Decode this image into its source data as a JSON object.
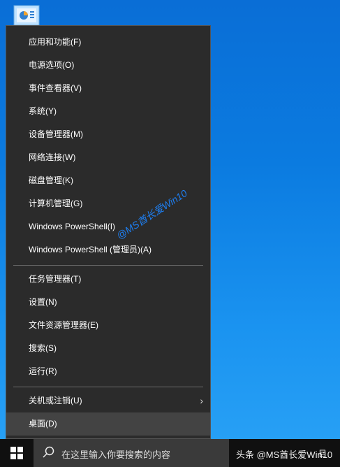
{
  "menu": {
    "items": [
      {
        "label": "应用和功能(F)"
      },
      {
        "label": "电源选项(O)"
      },
      {
        "label": "事件查看器(V)"
      },
      {
        "label": "系统(Y)"
      },
      {
        "label": "设备管理器(M)"
      },
      {
        "label": "网络连接(W)"
      },
      {
        "label": "磁盘管理(K)"
      },
      {
        "label": "计算机管理(G)"
      },
      {
        "label": "Windows PowerShell(I)"
      },
      {
        "label": "Windows PowerShell (管理员)(A)"
      },
      {
        "label": "任务管理器(T)"
      },
      {
        "label": "设置(N)"
      },
      {
        "label": "文件资源管理器(E)"
      },
      {
        "label": "搜索(S)"
      },
      {
        "label": "运行(R)"
      },
      {
        "label": "关机或注销(U)"
      },
      {
        "label": "桌面(D)"
      }
    ],
    "shutdown_chevron": "›"
  },
  "watermark": "@MS酋长爱Win10",
  "taskbar": {
    "search_placeholder": "在这里输入你要搜索的内容",
    "watermark": "头条 @MS酋长爱Win10",
    "right_text": "目"
  },
  "colors": {
    "accent": "#0b7be0",
    "menu_bg": "#2b2b2b",
    "taskbar_bg": "#101010"
  }
}
